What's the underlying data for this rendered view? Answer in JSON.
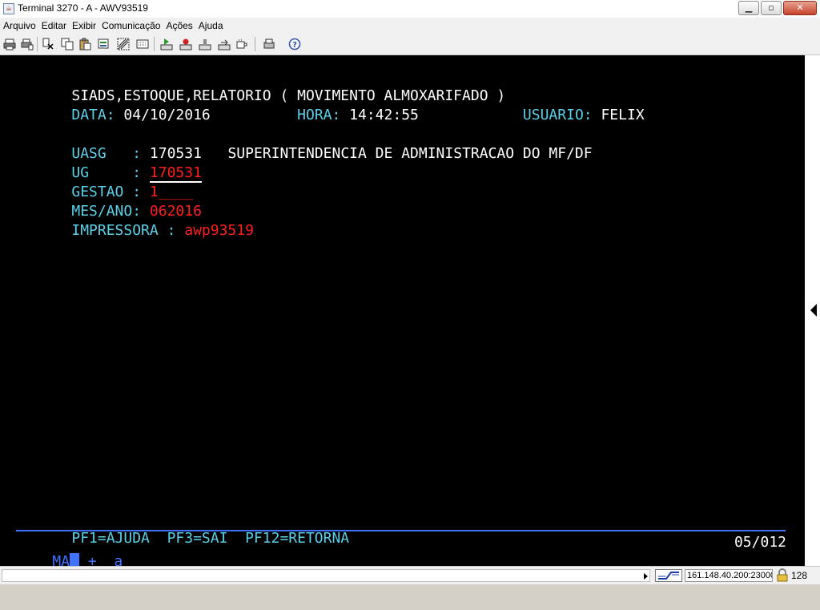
{
  "window": {
    "title": "Terminal 3270 - A - AWV93519",
    "controls": [
      "minimize",
      "maximize",
      "close"
    ]
  },
  "menu": [
    "Arquivo",
    "Editar",
    "Exibir",
    "Comunicação",
    "Ações",
    "Ajuda"
  ],
  "toolbar_icons": [
    "print-icon",
    "print-setup-icon",
    "cut-icon",
    "copy-icon",
    "paste-icon",
    "edit-icon",
    "select-all-icon",
    "macro-play-icon",
    "macro-record-icon",
    "disconnect-icon",
    "transfer-icon",
    "coffee-icon",
    "settings-icon",
    "help-icon"
  ],
  "terminal": {
    "line1": "SIADS,ESTOQUE,RELATORIO ( MOVIMENTO ALMOXARIFADO )",
    "data_label": "DATA:",
    "data_value": "04/10/2016",
    "hora_label": "HORA:",
    "hora_value": "14:42:55",
    "usuario_label": "USUARIO:",
    "usuario_value": "FELIX",
    "uasg_label": "UASG   :",
    "uasg_code": "170531",
    "uasg_name": "SUPERINTENDENCIA DE ADMINISTRACAO DO MF/DF",
    "ug_label": "UG     :",
    "ug_value": "170531",
    "gestao_label": "GESTAO :",
    "gestao_value": "1____",
    "mesano_label": "MES/ANO:",
    "mesano_value": "062016",
    "impressora_label": "IMPRESSORA :",
    "impressora_value": "awp93519",
    "pfkeys": "PF1=AJUDA  PF3=SAI  PF12=RETORNA",
    "oia_ma": "MA",
    "oia_plus": "+",
    "oia_a": "a",
    "cursor_pos": "05/012"
  },
  "status": {
    "host": "161.148.40.200:23000",
    "key_size": "128"
  },
  "colors": {
    "terminal_bg": "#000000",
    "field_label": "#5ad1e8",
    "text": "#ffffff",
    "input": "#ff1e1e",
    "oia": "#3f72ff"
  }
}
